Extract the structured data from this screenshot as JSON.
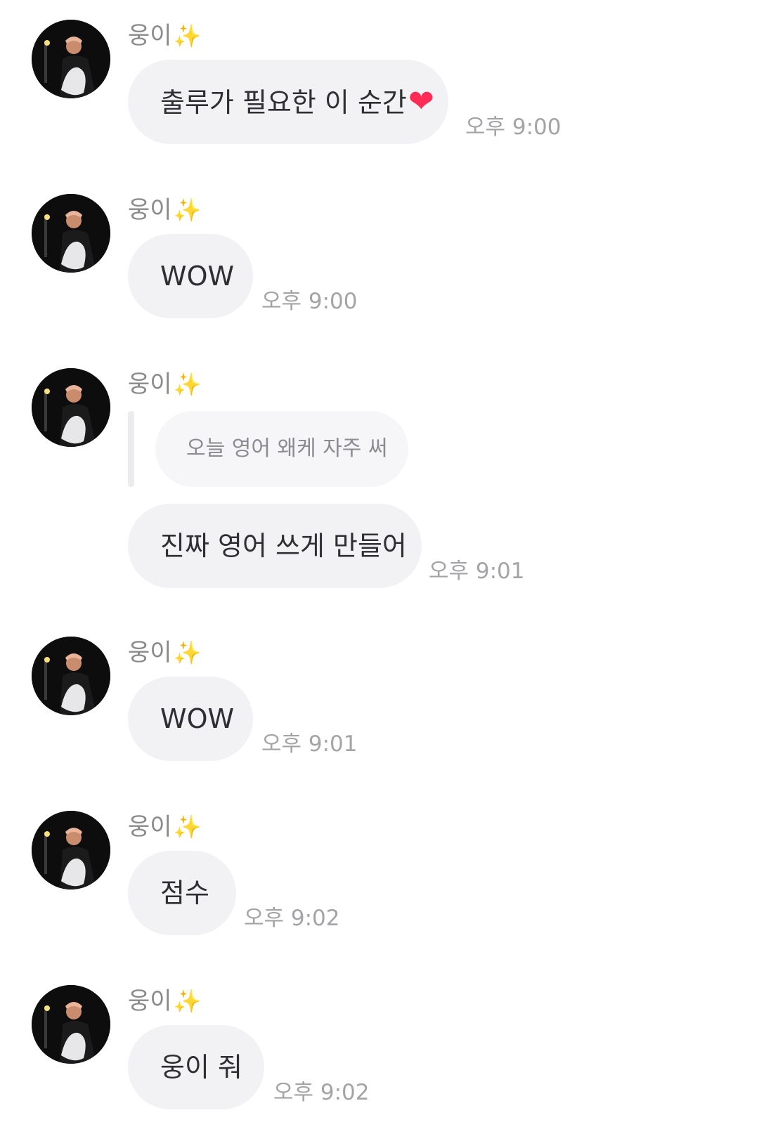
{
  "sender": {
    "name": "웅이",
    "name_emoji": "✨",
    "avatar_icon": "profile-photo"
  },
  "messages": [
    {
      "text": "출루가 필요한 이 순간",
      "emoji": "❤",
      "time": "오후 9:00"
    },
    {
      "text": "WOW",
      "time": "오후 9:00"
    },
    {
      "reply_to": "오늘 영어 왜케 자주 써",
      "text": "진짜 영어 쓰게 만들어",
      "time": "오후 9:01"
    },
    {
      "text": "WOW",
      "time": "오후 9:01"
    },
    {
      "text": "점수",
      "time": "오후 9:02"
    },
    {
      "text": "웅이 줘",
      "time": "오후 9:02"
    }
  ]
}
